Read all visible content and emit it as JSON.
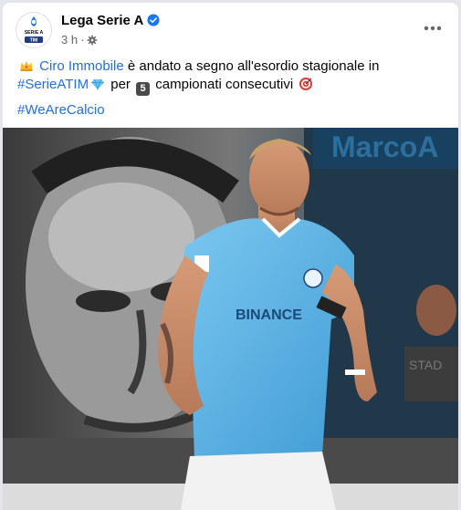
{
  "post": {
    "page_name": "Lega Serie A",
    "time": "3 h",
    "separator": "·",
    "text": {
      "mention": "Ciro Immobile",
      "after_mention": "è andato a segno all'esordio stagionale in",
      "hashtag1": "#SerieATIM",
      "per": "per",
      "number_badge": "5",
      "after_badge": "campionati consecutivi",
      "hashtag2": "#WeAreCalcio"
    },
    "photo": {
      "alt_icons": [
        "player-photo"
      ],
      "shirt_sponsor": "BINANCE",
      "banner_text": "MarcoA",
      "board_text": "STAD"
    },
    "avatar_text": {
      "line1": "SERIE A",
      "line2": "TIM"
    }
  },
  "colors": {
    "link": "#216fdb",
    "verified": "#1877f2",
    "secondary": "#65676b",
    "shirt": "#5fb7ea"
  },
  "icons": {
    "verified": "verified-badge-icon",
    "privacy": "gear-icon",
    "more": "more-options-icon",
    "crown": "crown-emoji-icon",
    "diamond": "diamond-emoji-icon",
    "target": "target-emoji-icon"
  }
}
